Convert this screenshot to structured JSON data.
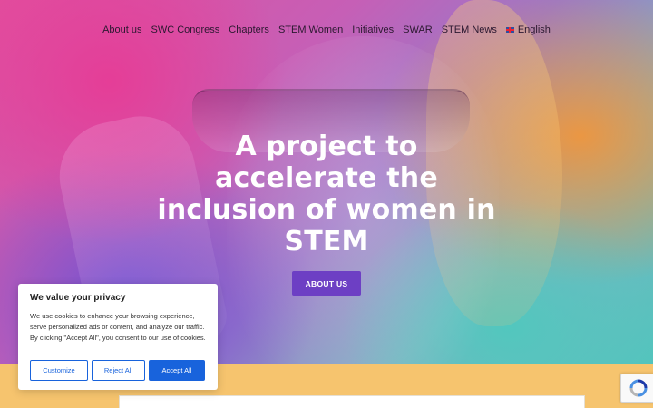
{
  "nav": {
    "items": [
      "About us",
      "SWC Congress",
      "Chapters",
      "STEM Women",
      "Initiatives",
      "SWAR",
      "STEM News"
    ],
    "language": "English"
  },
  "hero": {
    "headline": "A project to accelerate the inclusion of women in STEM",
    "cta_label": "ABOUT US"
  },
  "cookie_banner": {
    "title": "We value your privacy",
    "body": "We use cookies to enhance your browsing experience, serve personalized ads or content, and analyze our traffic. By clicking \"Accept All\", you consent to our use of cookies.",
    "customize_label": "Customize",
    "reject_label": "Reject All",
    "accept_label": "Accept All"
  },
  "colors": {
    "accent": "#6d3fc4",
    "cookie_blue": "#1863dc",
    "footer_band": "#f6c46e"
  },
  "icons": {
    "language_flag": "uk-flag-icon",
    "recaptcha": "recaptcha-icon"
  }
}
